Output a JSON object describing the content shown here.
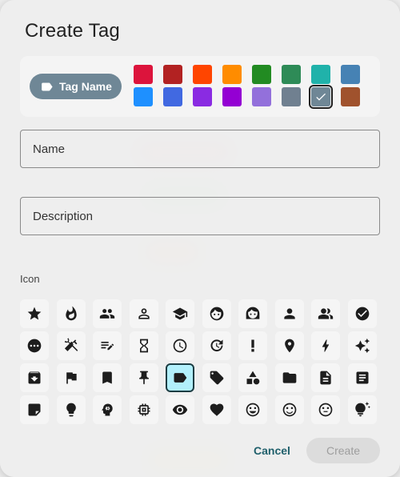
{
  "dialog": {
    "title": "Create Tag",
    "preview_label": "Tag Name",
    "preview_color": "#6f8796",
    "selected_color_index": 14
  },
  "colors": [
    "#dc143c",
    "#b22222",
    "#ff4500",
    "#ff8c00",
    "#228b22",
    "#2e8b57",
    "#20b2aa",
    "#4682b4",
    "#1e90ff",
    "#4169e1",
    "#8a2be2",
    "#9400d3",
    "#9370db",
    "#708090",
    "#6f8796",
    "#a0522d"
  ],
  "fields": {
    "name_placeholder": "Name",
    "description_placeholder": "Description"
  },
  "icon_section_label": "Icon",
  "icons": [
    "star-icon",
    "fire-icon",
    "group-icon",
    "person-outline-icon",
    "school-icon",
    "face-icon",
    "woman-icon",
    "person-icon",
    "people-icon",
    "check-circle-icon",
    "more-horiz-icon",
    "tools-icon",
    "edit-note-icon",
    "hourglass-icon",
    "clock-icon",
    "update-icon",
    "priority-icon",
    "location-pin-icon",
    "bolt-icon",
    "sparkle-icon",
    "archive-icon",
    "flag-icon",
    "bookmark-icon",
    "pin-icon",
    "label-icon",
    "tags-icon",
    "category-icon",
    "folder-icon",
    "document-icon",
    "article-icon",
    "sticky-note-icon",
    "lightbulb-icon",
    "psychology-icon",
    "memory-chip-icon",
    "eye-icon",
    "heart-icon",
    "smile-icon",
    "sentiment-icon",
    "neutral-face-icon",
    "tips-icon"
  ],
  "selected_icon": "label-icon",
  "actions": {
    "cancel_label": "Cancel",
    "create_label": "Create"
  }
}
